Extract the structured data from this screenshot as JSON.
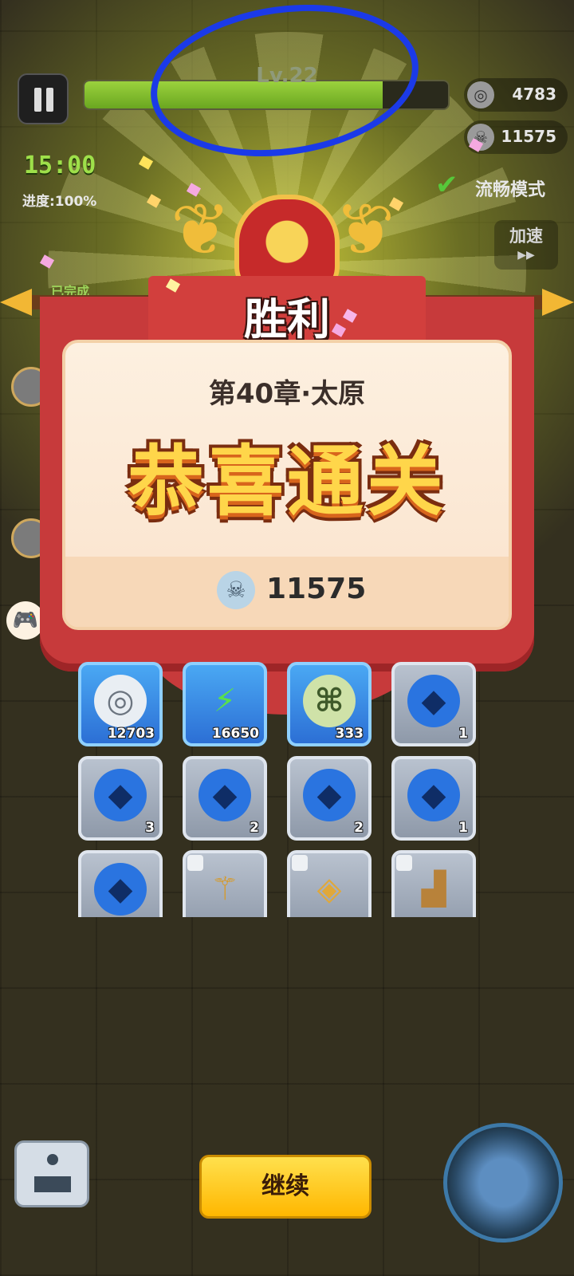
{
  "hud": {
    "level": "Lv.22",
    "coins": "4783",
    "kills": "11575",
    "timer": "15:00",
    "progress": "进度:100%",
    "smooth_mode": "流畅模式",
    "speed_up": "加速",
    "speed_icon": "▶▶",
    "completed": "已完成",
    "xp_fill_fraction": 0.82
  },
  "victory": {
    "title": "胜利",
    "chapter": "第40章·太原",
    "congrats": "恭喜通关",
    "kill_count": "11575"
  },
  "rewards": [
    {
      "icon": "silver-coin-icon",
      "count": "12703",
      "style": "blue"
    },
    {
      "icon": "lightning-icon",
      "count": "16650",
      "style": "blue"
    },
    {
      "icon": "scroll-icon",
      "count": "333",
      "style": "blue"
    },
    {
      "icon": "helmet-gem-icon",
      "count": "1",
      "style": "gray"
    },
    {
      "icon": "medal-gem-icon",
      "count": "3",
      "style": "gray"
    },
    {
      "icon": "glove-gem-icon",
      "count": "2",
      "style": "gray"
    },
    {
      "icon": "boot-gem-icon",
      "count": "2",
      "style": "gray"
    },
    {
      "icon": "armor-gem-icon",
      "count": "1",
      "style": "gray"
    },
    {
      "icon": "sword-gem-icon",
      "count": "",
      "style": "gray"
    },
    {
      "icon": "golden-staff-icon",
      "count": "",
      "style": "gray"
    },
    {
      "icon": "golden-armor-icon",
      "count": "",
      "style": "gray"
    },
    {
      "icon": "boots-icon",
      "count": "",
      "style": "gray"
    }
  ],
  "buttons": {
    "continue": "继续"
  },
  "colors": {
    "banner_red": "#c73a3b",
    "continue_yellow": "#ffc81a",
    "congrats_gold": "#ffd64a"
  }
}
